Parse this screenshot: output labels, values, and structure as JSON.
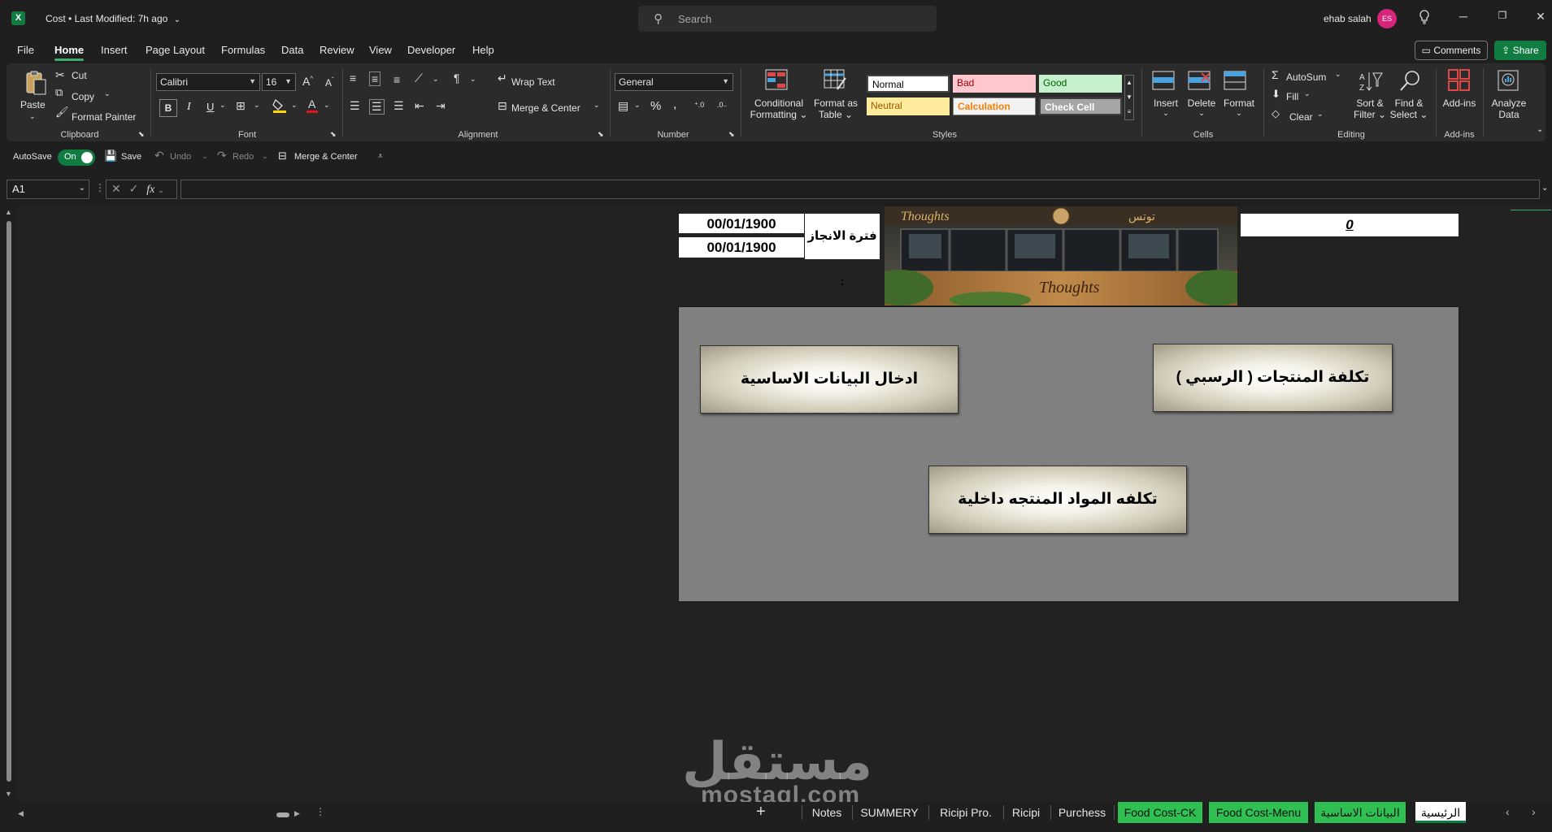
{
  "titlebar": {
    "app_icon": "excel-icon",
    "doc_name": "Cost",
    "separator": "•",
    "last_modified": "Last Modified: 7h ago",
    "search_placeholder": "Search",
    "user_name": "ehab salah",
    "user_initials": "ES"
  },
  "menu": {
    "tabs": [
      "File",
      "Home",
      "Insert",
      "Page Layout",
      "Formulas",
      "Data",
      "Review",
      "View",
      "Developer",
      "Help"
    ],
    "active": "Home",
    "comments": "Comments",
    "share": "Share"
  },
  "ribbon": {
    "clipboard": {
      "paste": "Paste",
      "cut": "Cut",
      "copy": "Copy",
      "format_painter": "Format Painter",
      "label": "Clipboard"
    },
    "font": {
      "name": "Calibri",
      "size": "16",
      "bold": "B",
      "italic": "I",
      "underline": "U",
      "label": "Font"
    },
    "alignment": {
      "wrap_text": "Wrap Text",
      "merge_center": "Merge & Center",
      "label": "Alignment"
    },
    "number": {
      "format": "General",
      "label": "Number"
    },
    "styles": {
      "conditional_1": "Conditional",
      "conditional_2": "Formatting",
      "table_1": "Format as",
      "table_2": "Table",
      "normal": "Normal",
      "bad": "Bad",
      "good": "Good",
      "neutral": "Neutral",
      "calculation": "Calculation",
      "check_cell": "Check Cell",
      "label": "Styles"
    },
    "cells": {
      "insert": "Insert",
      "delete": "Delete",
      "format": "Format",
      "label": "Cells"
    },
    "editing": {
      "autosum": "AutoSum",
      "fill": "Fill",
      "clear": "Clear",
      "sort_1": "Sort &",
      "sort_2": "Filter",
      "find_1": "Find &",
      "find_2": "Select",
      "label": "Editing"
    },
    "addins": {
      "addins": "Add-ins",
      "analyze_1": "Analyze",
      "analyze_2": "Data",
      "label": "Add-ins"
    },
    "colors": {
      "accent": "#107c41",
      "normal_bg": "#ffffff",
      "bad_bg": "#ffc7ce",
      "bad_fg": "#9c0006",
      "good_bg": "#c6efce",
      "good_fg": "#006100",
      "neutral_bg": "#ffeb9c",
      "neutral_fg": "#9c5700",
      "calc_bg": "#f2f2f2",
      "calc_fg": "#fa7d00",
      "check_bg": "#a5a5a5"
    }
  },
  "qat": {
    "autosave": "AutoSave",
    "autosave_state": "On",
    "save": "Save",
    "undo": "Undo",
    "redo": "Redo",
    "merge_center": "Merge & Center"
  },
  "formula_bar": {
    "name_box": "A1",
    "fx": "fx",
    "content": ""
  },
  "sheet": {
    "date_from": "00/01/1900",
    "date_to": "00/01/1900",
    "period_label": "فترة الانجاز :",
    "value": "0",
    "buttons": {
      "basic_data": "ادخال البيانات الاساسية",
      "product_cost": "تكلفة المنتجات ( الرسبي )",
      "internal_materials": "تكلفه المواد المنتجه داخلية"
    }
  },
  "watermark": {
    "arabic": "مستقل",
    "latin": "mostaql.com"
  },
  "sheet_tabs": {
    "items": [
      {
        "label": "Notes",
        "style": "plain"
      },
      {
        "label": "SUMMERY",
        "style": "plain"
      },
      {
        "label": "Ricipi Pro.",
        "style": "plain"
      },
      {
        "label": "Ricipi",
        "style": "plain"
      },
      {
        "label": "Purchess",
        "style": "plain"
      },
      {
        "label": "Food Cost-CK",
        "style": "green"
      },
      {
        "label": "Food Cost-Menu",
        "style": "green"
      },
      {
        "label": "البيانات الاساسية",
        "style": "green"
      },
      {
        "label": "الرئيسية",
        "style": "active"
      }
    ],
    "add": "+"
  }
}
